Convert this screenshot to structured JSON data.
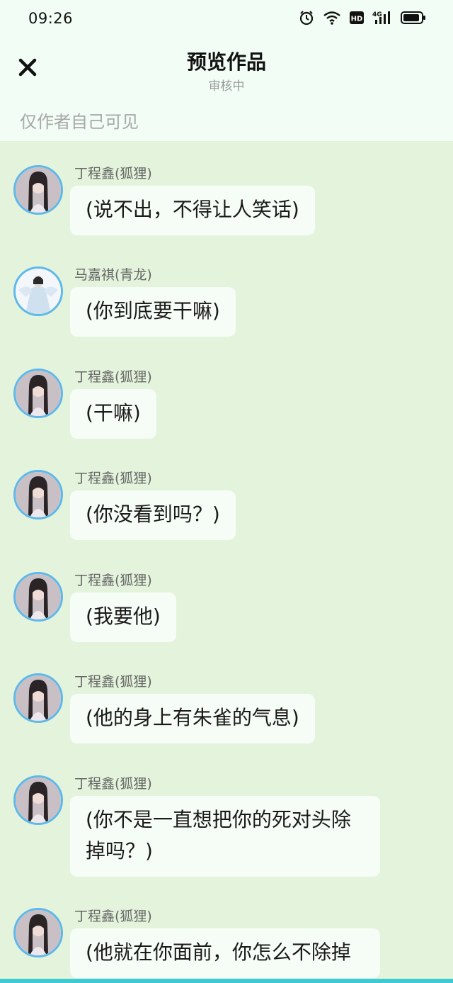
{
  "status_bar": {
    "time": "09:26",
    "icons": [
      "alarm-icon",
      "wifi-icon",
      "hd-icon",
      "signal-4g-icon",
      "battery-icon"
    ],
    "hd_label": "HD",
    "network_label": "4G"
  },
  "header": {
    "title": "预览作品",
    "subtitle": "审核中",
    "close_icon": "close-icon"
  },
  "visibility_note": "仅作者自己可见",
  "messages": [
    {
      "speaker": "丁程鑫(狐狸)",
      "avatar": "avatar-ding",
      "text": "(说不出，不得让人笑话)"
    },
    {
      "speaker": "马嘉祺(青龙)",
      "avatar": "avatar-ma",
      "text": "(你到底要干嘛)"
    },
    {
      "speaker": "丁程鑫(狐狸)",
      "avatar": "avatar-ding",
      "text": "(干嘛)"
    },
    {
      "speaker": "丁程鑫(狐狸)",
      "avatar": "avatar-ding",
      "text": "(你没看到吗？)"
    },
    {
      "speaker": "丁程鑫(狐狸)",
      "avatar": "avatar-ding",
      "text": "(我要他)"
    },
    {
      "speaker": "丁程鑫(狐狸)",
      "avatar": "avatar-ding",
      "text": "(他的身上有朱雀的气息)"
    },
    {
      "speaker": "丁程鑫(狐狸)",
      "avatar": "avatar-ding",
      "text": "(你不是一直想把你的死对头除掉吗？)"
    },
    {
      "speaker": "丁程鑫(狐狸)",
      "avatar": "avatar-ding",
      "text": "(他就在你面前，你怎么不除掉"
    }
  ],
  "colors": {
    "header_bg": "#f1fdf5",
    "chat_bg": "#e4f4dc",
    "bubble_bg": "#f6fcf6",
    "avatar_ring": "#5fb8ea"
  }
}
